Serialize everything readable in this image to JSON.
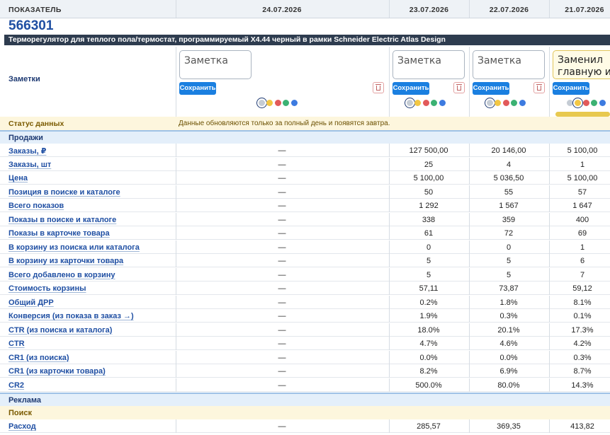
{
  "header": {
    "label_col": "ПОКАЗАТЕЛЬ",
    "dates": [
      "24.07.2026",
      "23.07.2026",
      "22.07.2026",
      "21.07.2026"
    ]
  },
  "product": {
    "id": "566301",
    "title": "Терморегулятор для теплого пола/термостат, программируемый X4.44 черный в рамки Schneider Electric Atlas Design"
  },
  "notes": {
    "label": "Заметки",
    "placeholder": "Заметка",
    "save_label": "Сохранить",
    "filled_text": "Заменил главную и",
    "colors": [
      "#c5ccd4",
      "#f2c744",
      "#e25a5a",
      "#3bb273",
      "#3d7be0"
    ],
    "trash_icon": "trash-icon"
  },
  "status": {
    "label": "Статус данных",
    "message": "Данные обновляются только за полный день и появятся завтра."
  },
  "sections": {
    "sales": "Продажи",
    "ads": "Реклама",
    "search": "Поиск"
  },
  "rows": [
    {
      "label": "Заказы, ₽",
      "values": [
        "—",
        "127 500,00",
        "20 146,00",
        "5 100,00"
      ]
    },
    {
      "label": "Заказы, шт",
      "values": [
        "—",
        "25",
        "4",
        "1"
      ]
    },
    {
      "label": "Цена",
      "values": [
        "—",
        "5 100,00",
        "5 036,50",
        "5 100,00"
      ]
    },
    {
      "label": "Позиция в поиске и каталоге",
      "values": [
        "—",
        "50",
        "55",
        "57"
      ]
    },
    {
      "label": "Всего показов",
      "values": [
        "—",
        "1 292",
        "1 567",
        "1 647"
      ]
    },
    {
      "label": "Показы в поиске и каталоге",
      "values": [
        "—",
        "338",
        "359",
        "400"
      ]
    },
    {
      "label": "Показы в карточке товара",
      "values": [
        "—",
        "61",
        "72",
        "69"
      ]
    },
    {
      "label": "В корзину из поиска или каталога",
      "values": [
        "—",
        "0",
        "0",
        "1"
      ]
    },
    {
      "label": "В корзину из карточки товара",
      "values": [
        "—",
        "5",
        "5",
        "6"
      ]
    },
    {
      "label": "Всего добавлено в корзину",
      "values": [
        "—",
        "5",
        "5",
        "7"
      ]
    },
    {
      "label": "Стоимость корзины",
      "values": [
        "—",
        "57,11",
        "73,87",
        "59,12"
      ]
    },
    {
      "label": "Общий ДРР",
      "values": [
        "—",
        "0.2%",
        "1.8%",
        "8.1%"
      ]
    },
    {
      "label": "Конверсия (из показа в заказ →)",
      "values": [
        "—",
        "1.9%",
        "0.3%",
        "0.1%"
      ]
    },
    {
      "label": "CTR (из поиска и каталога)",
      "values": [
        "—",
        "18.0%",
        "20.1%",
        "17.3%"
      ]
    },
    {
      "label": "CTR",
      "values": [
        "—",
        "4.7%",
        "4.6%",
        "4.2%"
      ]
    },
    {
      "label": "CR1 (из поиска)",
      "values": [
        "—",
        "0.0%",
        "0.0%",
        "0.3%"
      ]
    },
    {
      "label": "CR1 (из карточки товара)",
      "values": [
        "—",
        "8.2%",
        "6.9%",
        "8.7%"
      ]
    },
    {
      "label": "CR2",
      "values": [
        "—",
        "500.0%",
        "80.0%",
        "14.3%"
      ]
    }
  ],
  "ads_rows": [
    {
      "label": "Расход",
      "values": [
        "—",
        "285,57",
        "369,35",
        "413,82"
      ]
    }
  ]
}
